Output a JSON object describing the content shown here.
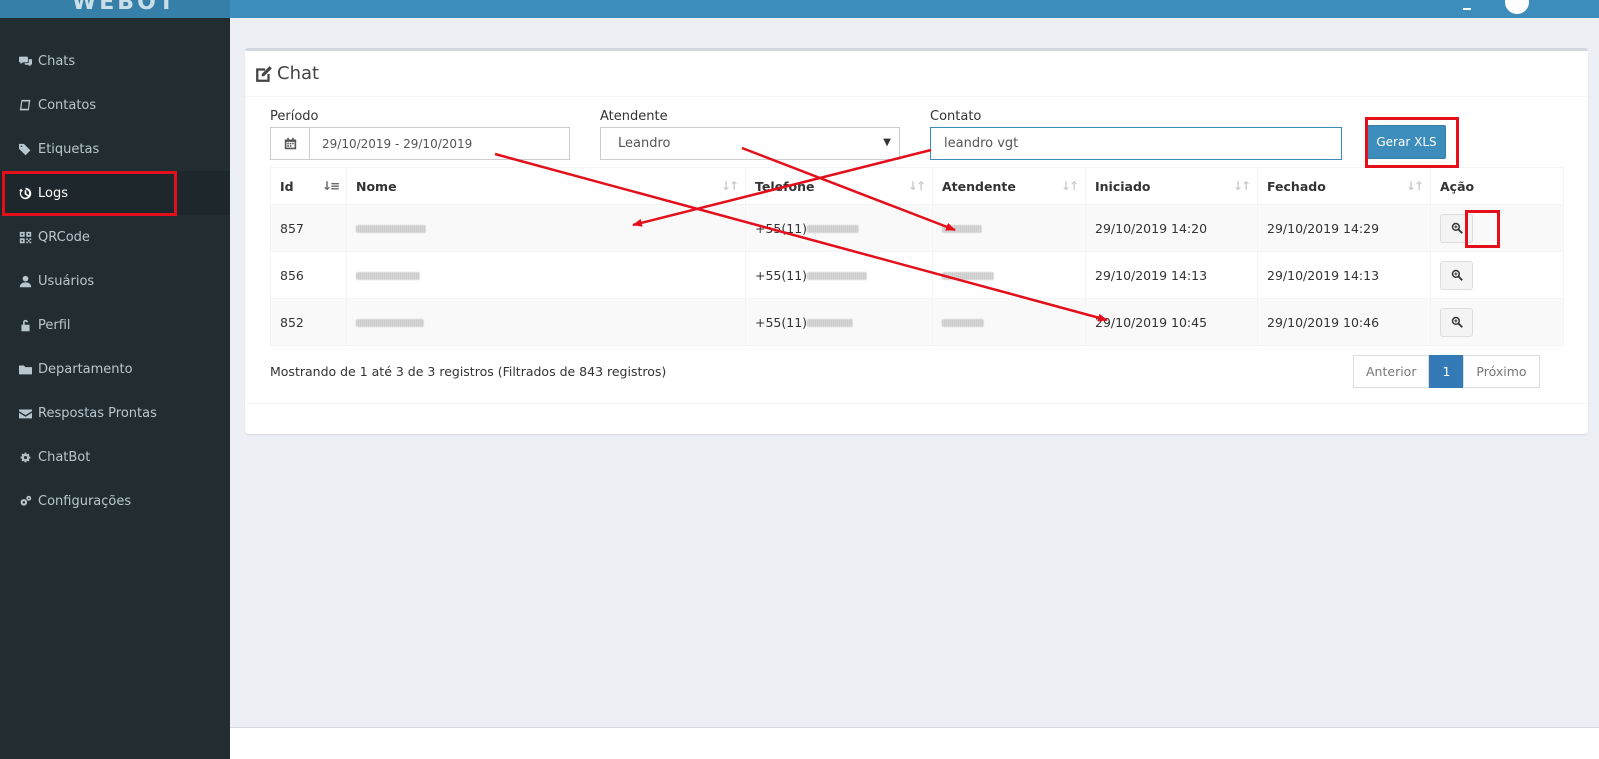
{
  "app": {
    "brand": "WEBOT"
  },
  "sidebar": {
    "items": [
      {
        "label": "Chats",
        "icon": "comments-icon"
      },
      {
        "label": "Contatos",
        "icon": "book-icon"
      },
      {
        "label": "Etiquetas",
        "icon": "tags-icon"
      },
      {
        "label": "Logs",
        "icon": "history-icon"
      },
      {
        "label": "QRCode",
        "icon": "qrcode-icon"
      },
      {
        "label": "Usuários",
        "icon": "user-icon"
      },
      {
        "label": "Perfil",
        "icon": "unlock-icon"
      },
      {
        "label": "Departamento",
        "icon": "folder-icon"
      },
      {
        "label": "Respostas Prontas",
        "icon": "envelope-icon"
      },
      {
        "label": "ChatBot",
        "icon": "cog-icon"
      },
      {
        "label": "Configurações",
        "icon": "cogs-icon"
      }
    ],
    "active": "Logs"
  },
  "box": {
    "title": "Chat",
    "icon": "edit-icon"
  },
  "filters": {
    "periodo_label": "Período",
    "periodo_value": "29/10/2019 - 29/10/2019",
    "atendente_label": "Atendente",
    "atendente_value": "Leandro",
    "contato_label": "Contato",
    "contato_value": "leandro vgt",
    "export_button": "Gerar XLS"
  },
  "table": {
    "columns": [
      "Id",
      "Nome",
      "Telefone",
      "Atendente",
      "Iniciado",
      "Fechado",
      "Ação"
    ],
    "rows": [
      {
        "id": "857",
        "telefone": "+55(11)",
        "iniciado": "29/10/2019 14:20",
        "fechado": "29/10/2019 14:29"
      },
      {
        "id": "856",
        "telefone": "+55(11)",
        "iniciado": "29/10/2019 14:13",
        "fechado": "29/10/2019 14:13"
      },
      {
        "id": "852",
        "telefone": "+55(11)",
        "iniciado": "29/10/2019 10:45",
        "fechado": "29/10/2019 10:46"
      }
    ]
  },
  "footer": {
    "info": "Mostrando de 1 até 3 de 3 registros (Filtrados de 843 registros)",
    "prev": "Anterior",
    "page": "1",
    "next": "Próximo"
  },
  "colors": {
    "header": "#3c8dbc",
    "sidebar": "#222d32",
    "annotation": "#e3101b"
  }
}
